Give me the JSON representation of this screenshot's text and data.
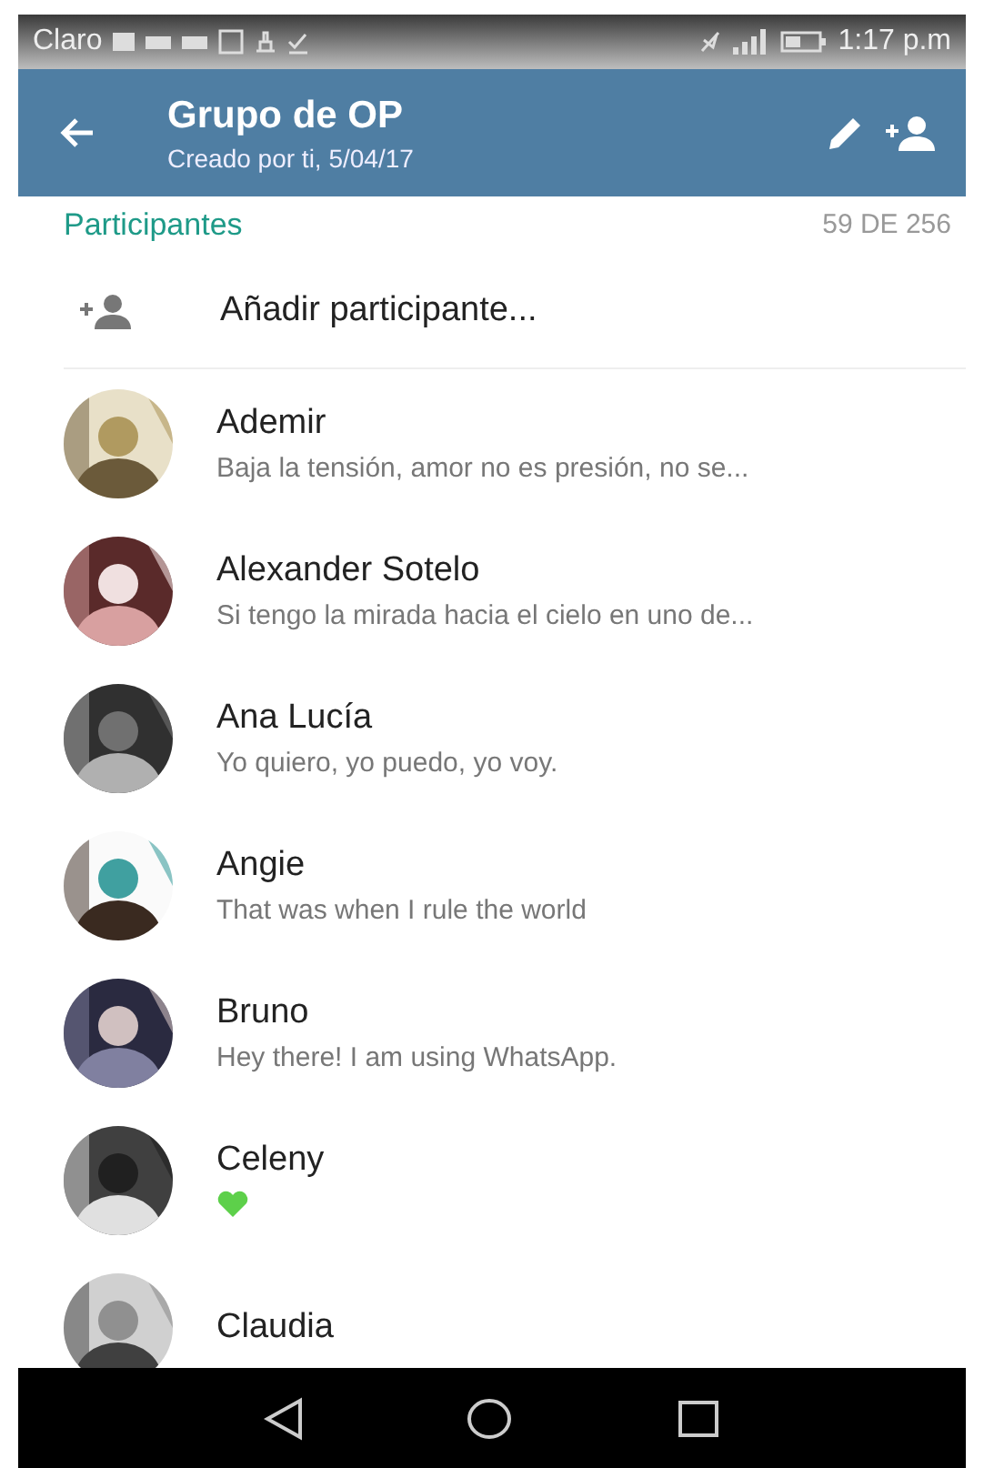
{
  "status_bar": {
    "carrier": "Claro",
    "time": "1:17 p.m"
  },
  "app_bar": {
    "title": "Grupo de OP",
    "subtitle": "Creado por ti, 5/04/17"
  },
  "participants_header": {
    "label": "Participantes",
    "count": "59 DE 256"
  },
  "add_participant": {
    "label": "Añadir participante..."
  },
  "participants": [
    {
      "name": "Ademir",
      "kind": "text",
      "status": "Baja la tensión, amor no es presión, no se..."
    },
    {
      "name": "Alexander Sotelo",
      "kind": "text",
      "status": "Si tengo la mirada hacia el cielo en uno de..."
    },
    {
      "name": "Ana Lucía",
      "kind": "text",
      "status": "Yo quiero, yo puedo, yo voy."
    },
    {
      "name": "Angie",
      "kind": "text",
      "status": "That was when I rule the world"
    },
    {
      "name": "Bruno",
      "kind": "text",
      "status": "Hey there! I am using WhatsApp."
    },
    {
      "name": "Celeny",
      "kind": "heart"
    },
    {
      "name": "Claudia",
      "kind": "none"
    }
  ]
}
